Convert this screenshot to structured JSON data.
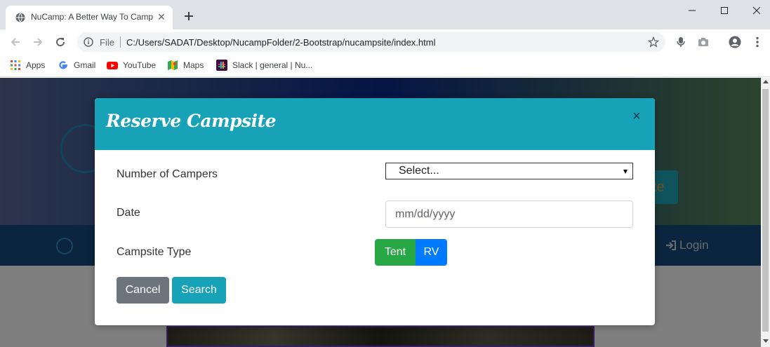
{
  "browser": {
    "tab_title": "NuCamp: A Better Way To Camp",
    "address_scheme": "File",
    "address_url": "C:/Users/SADAT/Desktop/NucampFolder/2-Bootstrap/nucampsite/index.html",
    "bookmarks": [
      {
        "label": "Apps",
        "icon": "apps-grid-icon"
      },
      {
        "label": "Gmail",
        "icon": "google-icon"
      },
      {
        "label": "YouTube",
        "icon": "youtube-icon"
      },
      {
        "label": "Maps",
        "icon": "maps-icon"
      },
      {
        "label": "Slack | general | Nu...",
        "icon": "slack-icon"
      }
    ]
  },
  "page": {
    "reserve_button_fragment": "te",
    "nav_login": "Login"
  },
  "modal": {
    "title": "Reserve Campsite",
    "close_label": "×",
    "fields": {
      "campers_label": "Number of Campers",
      "campers_value": "Select...",
      "date_label": "Date",
      "date_placeholder": "mm/dd/yyyy",
      "type_label": "Campsite Type"
    },
    "buttons": {
      "tent": "Tent",
      "rv": "RV",
      "cancel": "Cancel",
      "search": "Search"
    }
  },
  "colors": {
    "modal_header": "#17a2b8",
    "tent": "#28a745",
    "rv": "#007bff",
    "cancel": "#6c757d",
    "search": "#17a2b8"
  }
}
